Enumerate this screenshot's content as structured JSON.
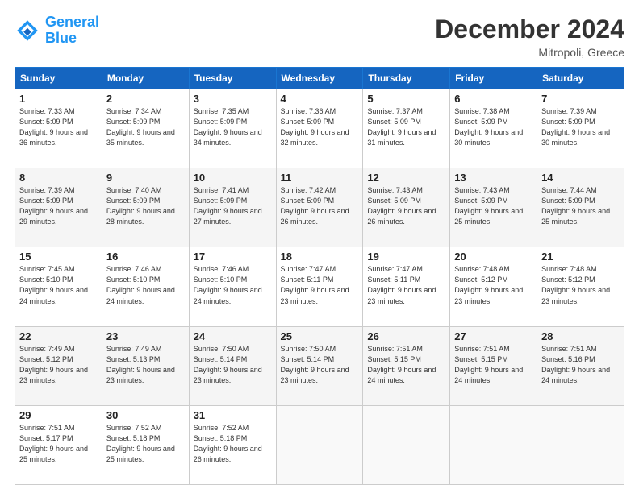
{
  "header": {
    "logo_line1": "General",
    "logo_line2": "Blue",
    "month": "December 2024",
    "location": "Mitropoli, Greece"
  },
  "weekdays": [
    "Sunday",
    "Monday",
    "Tuesday",
    "Wednesday",
    "Thursday",
    "Friday",
    "Saturday"
  ],
  "weeks": [
    [
      {
        "day": "1",
        "sunrise": "Sunrise: 7:33 AM",
        "sunset": "Sunset: 5:09 PM",
        "daylight": "Daylight: 9 hours and 36 minutes."
      },
      {
        "day": "2",
        "sunrise": "Sunrise: 7:34 AM",
        "sunset": "Sunset: 5:09 PM",
        "daylight": "Daylight: 9 hours and 35 minutes."
      },
      {
        "day": "3",
        "sunrise": "Sunrise: 7:35 AM",
        "sunset": "Sunset: 5:09 PM",
        "daylight": "Daylight: 9 hours and 34 minutes."
      },
      {
        "day": "4",
        "sunrise": "Sunrise: 7:36 AM",
        "sunset": "Sunset: 5:09 PM",
        "daylight": "Daylight: 9 hours and 32 minutes."
      },
      {
        "day": "5",
        "sunrise": "Sunrise: 7:37 AM",
        "sunset": "Sunset: 5:09 PM",
        "daylight": "Daylight: 9 hours and 31 minutes."
      },
      {
        "day": "6",
        "sunrise": "Sunrise: 7:38 AM",
        "sunset": "Sunset: 5:09 PM",
        "daylight": "Daylight: 9 hours and 30 minutes."
      },
      {
        "day": "7",
        "sunrise": "Sunrise: 7:39 AM",
        "sunset": "Sunset: 5:09 PM",
        "daylight": "Daylight: 9 hours and 30 minutes."
      }
    ],
    [
      {
        "day": "8",
        "sunrise": "Sunrise: 7:39 AM",
        "sunset": "Sunset: 5:09 PM",
        "daylight": "Daylight: 9 hours and 29 minutes."
      },
      {
        "day": "9",
        "sunrise": "Sunrise: 7:40 AM",
        "sunset": "Sunset: 5:09 PM",
        "daylight": "Daylight: 9 hours and 28 minutes."
      },
      {
        "day": "10",
        "sunrise": "Sunrise: 7:41 AM",
        "sunset": "Sunset: 5:09 PM",
        "daylight": "Daylight: 9 hours and 27 minutes."
      },
      {
        "day": "11",
        "sunrise": "Sunrise: 7:42 AM",
        "sunset": "Sunset: 5:09 PM",
        "daylight": "Daylight: 9 hours and 26 minutes."
      },
      {
        "day": "12",
        "sunrise": "Sunrise: 7:43 AM",
        "sunset": "Sunset: 5:09 PM",
        "daylight": "Daylight: 9 hours and 26 minutes."
      },
      {
        "day": "13",
        "sunrise": "Sunrise: 7:43 AM",
        "sunset": "Sunset: 5:09 PM",
        "daylight": "Daylight: 9 hours and 25 minutes."
      },
      {
        "day": "14",
        "sunrise": "Sunrise: 7:44 AM",
        "sunset": "Sunset: 5:09 PM",
        "daylight": "Daylight: 9 hours and 25 minutes."
      }
    ],
    [
      {
        "day": "15",
        "sunrise": "Sunrise: 7:45 AM",
        "sunset": "Sunset: 5:10 PM",
        "daylight": "Daylight: 9 hours and 24 minutes."
      },
      {
        "day": "16",
        "sunrise": "Sunrise: 7:46 AM",
        "sunset": "Sunset: 5:10 PM",
        "daylight": "Daylight: 9 hours and 24 minutes."
      },
      {
        "day": "17",
        "sunrise": "Sunrise: 7:46 AM",
        "sunset": "Sunset: 5:10 PM",
        "daylight": "Daylight: 9 hours and 24 minutes."
      },
      {
        "day": "18",
        "sunrise": "Sunrise: 7:47 AM",
        "sunset": "Sunset: 5:11 PM",
        "daylight": "Daylight: 9 hours and 23 minutes."
      },
      {
        "day": "19",
        "sunrise": "Sunrise: 7:47 AM",
        "sunset": "Sunset: 5:11 PM",
        "daylight": "Daylight: 9 hours and 23 minutes."
      },
      {
        "day": "20",
        "sunrise": "Sunrise: 7:48 AM",
        "sunset": "Sunset: 5:12 PM",
        "daylight": "Daylight: 9 hours and 23 minutes."
      },
      {
        "day": "21",
        "sunrise": "Sunrise: 7:48 AM",
        "sunset": "Sunset: 5:12 PM",
        "daylight": "Daylight: 9 hours and 23 minutes."
      }
    ],
    [
      {
        "day": "22",
        "sunrise": "Sunrise: 7:49 AM",
        "sunset": "Sunset: 5:12 PM",
        "daylight": "Daylight: 9 hours and 23 minutes."
      },
      {
        "day": "23",
        "sunrise": "Sunrise: 7:49 AM",
        "sunset": "Sunset: 5:13 PM",
        "daylight": "Daylight: 9 hours and 23 minutes."
      },
      {
        "day": "24",
        "sunrise": "Sunrise: 7:50 AM",
        "sunset": "Sunset: 5:14 PM",
        "daylight": "Daylight: 9 hours and 23 minutes."
      },
      {
        "day": "25",
        "sunrise": "Sunrise: 7:50 AM",
        "sunset": "Sunset: 5:14 PM",
        "daylight": "Daylight: 9 hours and 23 minutes."
      },
      {
        "day": "26",
        "sunrise": "Sunrise: 7:51 AM",
        "sunset": "Sunset: 5:15 PM",
        "daylight": "Daylight: 9 hours and 24 minutes."
      },
      {
        "day": "27",
        "sunrise": "Sunrise: 7:51 AM",
        "sunset": "Sunset: 5:15 PM",
        "daylight": "Daylight: 9 hours and 24 minutes."
      },
      {
        "day": "28",
        "sunrise": "Sunrise: 7:51 AM",
        "sunset": "Sunset: 5:16 PM",
        "daylight": "Daylight: 9 hours and 24 minutes."
      }
    ],
    [
      {
        "day": "29",
        "sunrise": "Sunrise: 7:51 AM",
        "sunset": "Sunset: 5:17 PM",
        "daylight": "Daylight: 9 hours and 25 minutes."
      },
      {
        "day": "30",
        "sunrise": "Sunrise: 7:52 AM",
        "sunset": "Sunset: 5:18 PM",
        "daylight": "Daylight: 9 hours and 25 minutes."
      },
      {
        "day": "31",
        "sunrise": "Sunrise: 7:52 AM",
        "sunset": "Sunset: 5:18 PM",
        "daylight": "Daylight: 9 hours and 26 minutes."
      },
      null,
      null,
      null,
      null
    ]
  ]
}
